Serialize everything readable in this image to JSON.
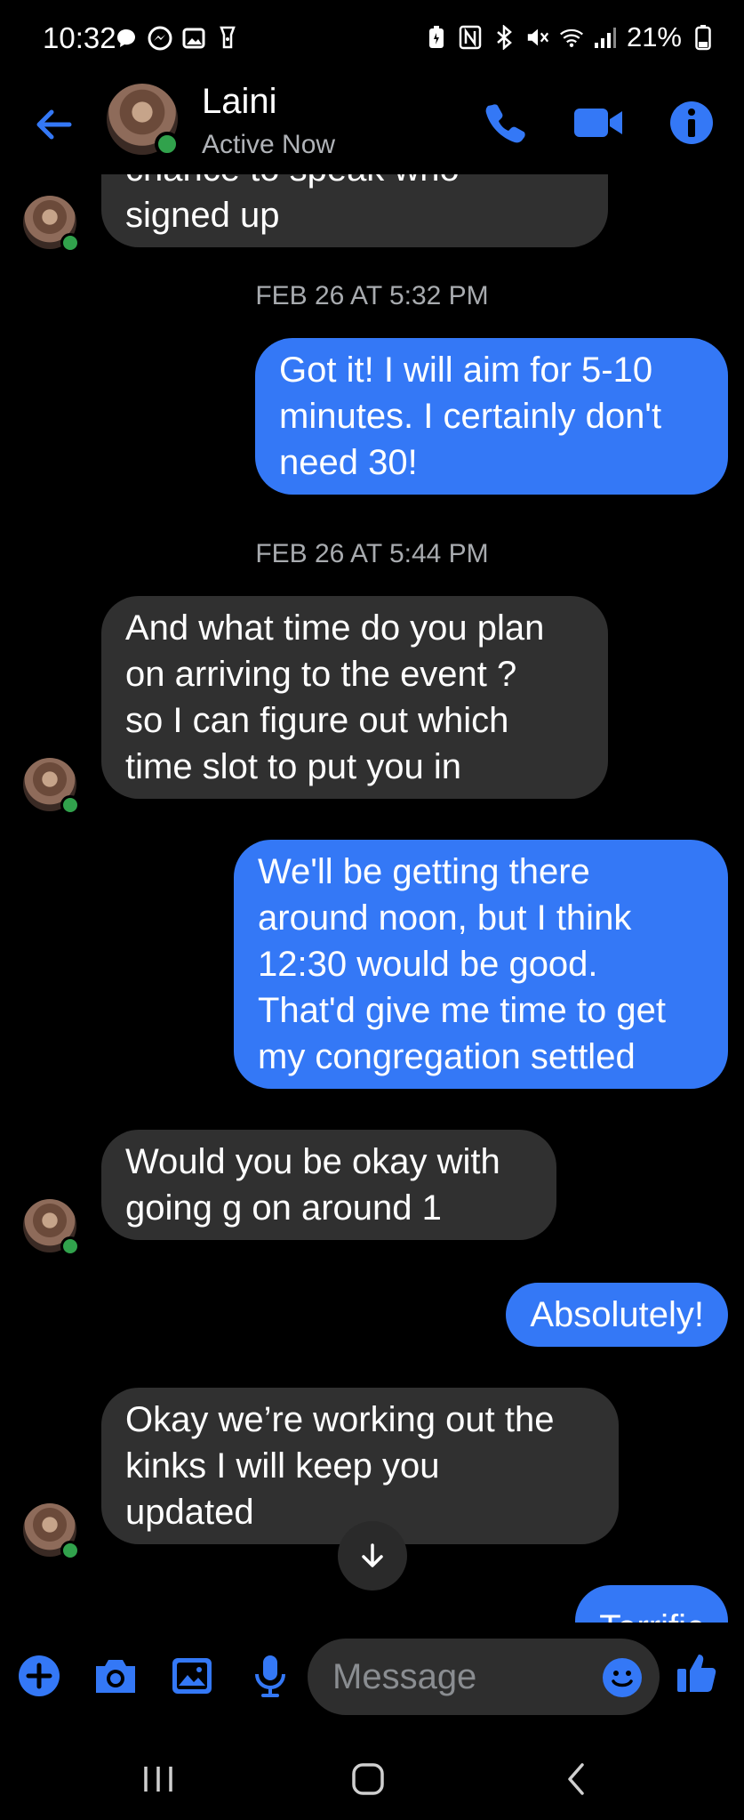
{
  "status_bar": {
    "time": "10:32",
    "battery_percent": "21%",
    "left_icons": [
      "chat-bubble-icon",
      "messenger-icon",
      "gallery-icon",
      "flashlight-icon"
    ],
    "right_icons": [
      "battery-saver-icon",
      "nfc-icon",
      "bluetooth-icon",
      "mute-icon",
      "wifi-icon",
      "signal-icon",
      "battery-icon"
    ]
  },
  "header": {
    "contact_name": "Laini",
    "contact_status": "Active Now",
    "icons": [
      "back-arrow-icon",
      "phone-icon",
      "video-camera-icon",
      "info-icon"
    ]
  },
  "messages": [
    {
      "direction": "incoming",
      "text_lines": [
        "chance to speak who",
        "signed up"
      ],
      "partial": true
    },
    {
      "type": "timestamp",
      "text": "FEB 26 AT 5:32 PM"
    },
    {
      "direction": "outgoing",
      "text_lines": [
        "Got it! I will aim for 5-10",
        "minutes. I certainly don't",
        "need 30!"
      ]
    },
    {
      "type": "timestamp",
      "text": "FEB 26 AT 5:44 PM"
    },
    {
      "direction": "incoming",
      "text_lines": [
        "And what time do you plan",
        "on arriving to the event ?",
        "so I can figure out which",
        "time slot to put you in"
      ]
    },
    {
      "direction": "outgoing",
      "text_lines": [
        "We'll be getting there",
        "around noon, but I think",
        "12:30 would be good.",
        "That'd give me time to get",
        "my congregation settled"
      ]
    },
    {
      "direction": "incoming",
      "text_lines": [
        "Would you be okay with",
        "going g on around 1"
      ]
    },
    {
      "direction": "outgoing",
      "text_lines": [
        "Absolutely!"
      ]
    },
    {
      "direction": "incoming",
      "text_lines": [
        "Okay we’re working out the",
        "kinks I will keep you",
        "updated"
      ]
    },
    {
      "direction": "outgoing",
      "text_lines": [
        "Terrific"
      ],
      "partial": true
    }
  ],
  "composer": {
    "placeholder": "Message",
    "icons": [
      "plus-icon",
      "camera-icon",
      "gallery-icon",
      "microphone-icon",
      "emoji-icon",
      "thumbs-up-icon"
    ]
  },
  "navbar": {
    "icons": [
      "recents-icon",
      "home-icon",
      "back-icon"
    ]
  },
  "colors": {
    "accent": "#3478f6",
    "incoming_bubble": "#303030",
    "online": "#31a24c",
    "background": "#000000"
  }
}
